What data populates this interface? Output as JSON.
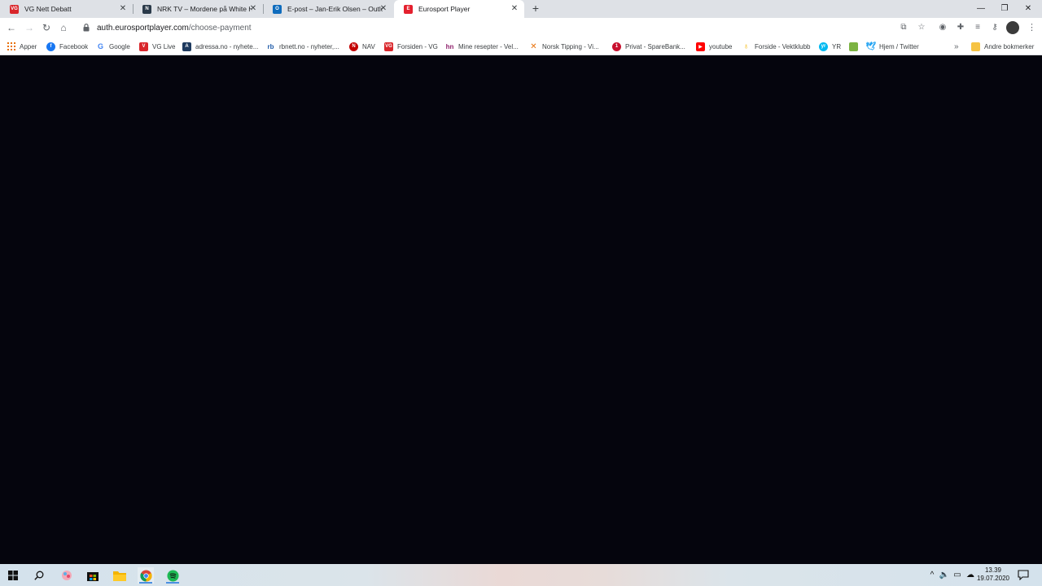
{
  "browser": {
    "tabs": [
      {
        "title": "VG Nett Debatt",
        "favicon": "vg-icon",
        "color": "#d9262b"
      },
      {
        "title": "NRK TV – Mordene på White House Farm",
        "favicon": "nrk-icon",
        "color": "#2b3a4a"
      },
      {
        "title": "E-post – Jan-Erik Olsen – Outlook",
        "favicon": "outlook-icon",
        "color": "#0f6cbd"
      },
      {
        "title": "Eurosport Player",
        "favicon": "eurosport-icon",
        "color": "#e4202e"
      }
    ],
    "url": {
      "domain": "auth.eurosportplayer.com",
      "path": "/choose-payment"
    }
  },
  "bookmarks": [
    {
      "label": "Apper",
      "icon": "apps-grid-icon"
    },
    {
      "label": "Facebook",
      "icon": "facebook-icon"
    },
    {
      "label": "Google",
      "icon": "google-icon"
    },
    {
      "label": "VG Live",
      "icon": "vg-live-icon"
    },
    {
      "label": "adressa.no - nyhete...",
      "icon": "adressa-icon"
    },
    {
      "label": "rbnett.no - nyheter,...",
      "icon": "rbnett-icon"
    },
    {
      "label": "NAV",
      "icon": "nav-icon"
    },
    {
      "label": "Forsiden - VG",
      "icon": "vg-icon"
    },
    {
      "label": "Mine resepter - Vel...",
      "icon": "helsenorge-icon"
    },
    {
      "label": "Norsk Tipping - Vi...",
      "icon": "norsk-tipping-icon"
    },
    {
      "label": "Privat - SpareBank...",
      "icon": "sparebank-icon"
    },
    {
      "label": "youtube",
      "icon": "youtube-icon"
    },
    {
      "label": "Forside - Vektklubb",
      "icon": "vektklubb-icon"
    },
    {
      "label": "YR",
      "icon": "yr-icon"
    },
    {
      "label": "",
      "icon": "bookmark-icon"
    },
    {
      "label": "Hjem / Twitter",
      "icon": "twitter-icon"
    }
  ],
  "other_bookmarks": "Andre bokmerker",
  "taskbar": {
    "time": "13.39",
    "date": "19.07.2020"
  }
}
